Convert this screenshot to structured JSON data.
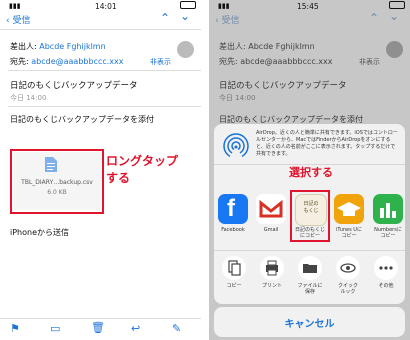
{
  "left": {
    "status": {
      "time": "14:01"
    },
    "nav": {
      "back": "受信"
    },
    "sender_label": "差出人:",
    "sender": "Abcde Fghijklmn",
    "to_label": "宛先:",
    "to": "abcde@aaabbbccc.xxx",
    "hide": "非表示",
    "subject": "日記のもくじバックアップデータ",
    "date": "今日 14:00",
    "body": "日記のもくじバックアップデータを添付",
    "attachment": {
      "name": "TBL_DIARY…backup.csv",
      "size": "6.0 KB"
    },
    "callout": [
      "ロングタップ",
      "する"
    ],
    "signature": "iPhoneから送信"
  },
  "right": {
    "status": {
      "time": "15:45"
    },
    "nav": {
      "back": "受信"
    },
    "sender_label": "差出人:",
    "sender": "Abcde Fghijklmn",
    "to_label": "宛先:",
    "to": "abcde@aaabbbccc.xxx",
    "hide": "非表示",
    "subject": "日記のもくじバックアップデータ",
    "date": "今日 14:00",
    "body": "日記のもくじバックアップデータを添付",
    "airdrop_text": "AirDrop。近くの人と簡単に共有できます。iOSではコントロールセンターから、MacではFinderからAirDropをオンにすると、近くの人の名前がここに表示されます。タップするだけで共有できます。",
    "select_callout": "選択する",
    "highlight_icon_lines": [
      "日記の",
      "もくじ"
    ],
    "apps": [
      {
        "label": "Facebook",
        "icon": "facebook-icon",
        "color": "#1877f2"
      },
      {
        "label": "Gmail",
        "icon": "gmail-icon",
        "color": "#ffffff"
      },
      {
        "label": "日記のもくじ\nにコピー",
        "icon": "diary-app-icon",
        "color": "#f4efe0"
      },
      {
        "label": "iTunes Uに\nコピー",
        "icon": "itunes-u-icon",
        "color": "#f0a30a"
      },
      {
        "label": "Numbersに\nコピー",
        "icon": "numbers-icon",
        "color": "#2fb24c"
      }
    ],
    "actions": [
      {
        "label": "コピー",
        "icon": "copy-icon"
      },
      {
        "label": "プリント",
        "icon": "print-icon"
      },
      {
        "label": "ファイルに\n保存",
        "icon": "folder-icon"
      },
      {
        "label": "クイック\nルック",
        "icon": "eye-icon"
      },
      {
        "label": "その他",
        "icon": "more-icon"
      }
    ],
    "cancel": "キャンセル"
  }
}
